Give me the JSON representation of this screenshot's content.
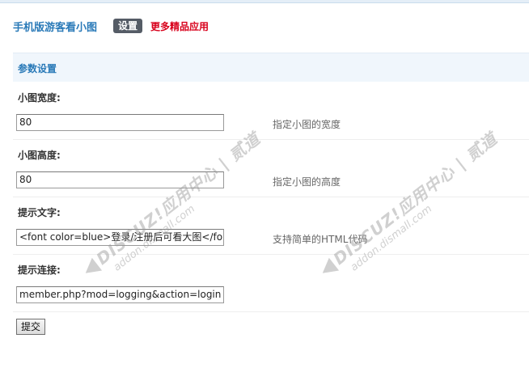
{
  "header": {
    "title": "手机版游客看小图",
    "active_tab": "设置",
    "more_link": "更多精品应用"
  },
  "section": {
    "title": "参数设置"
  },
  "fields": [
    {
      "label": "小图宽度:",
      "value": "80",
      "hint": "指定小图的宽度"
    },
    {
      "label": "小图高度:",
      "value": "80",
      "hint": "指定小图的高度"
    },
    {
      "label": "提示文字:",
      "value": "<font color=blue>登录/注册后可看大图</fo",
      "hint": "支持简单的HTML代码"
    },
    {
      "label": "提示连接:",
      "value": "member.php?mod=logging&action=login",
      "hint": ""
    }
  ],
  "submit_label": "提交",
  "watermark": {
    "brand": "DISCUZ!应用中心 | 贰道",
    "domain": "addon.dismall.com"
  },
  "colors": {
    "accent": "#2a7ab8",
    "link_red": "#d8001b",
    "section_bg": "#f0f6fc"
  }
}
